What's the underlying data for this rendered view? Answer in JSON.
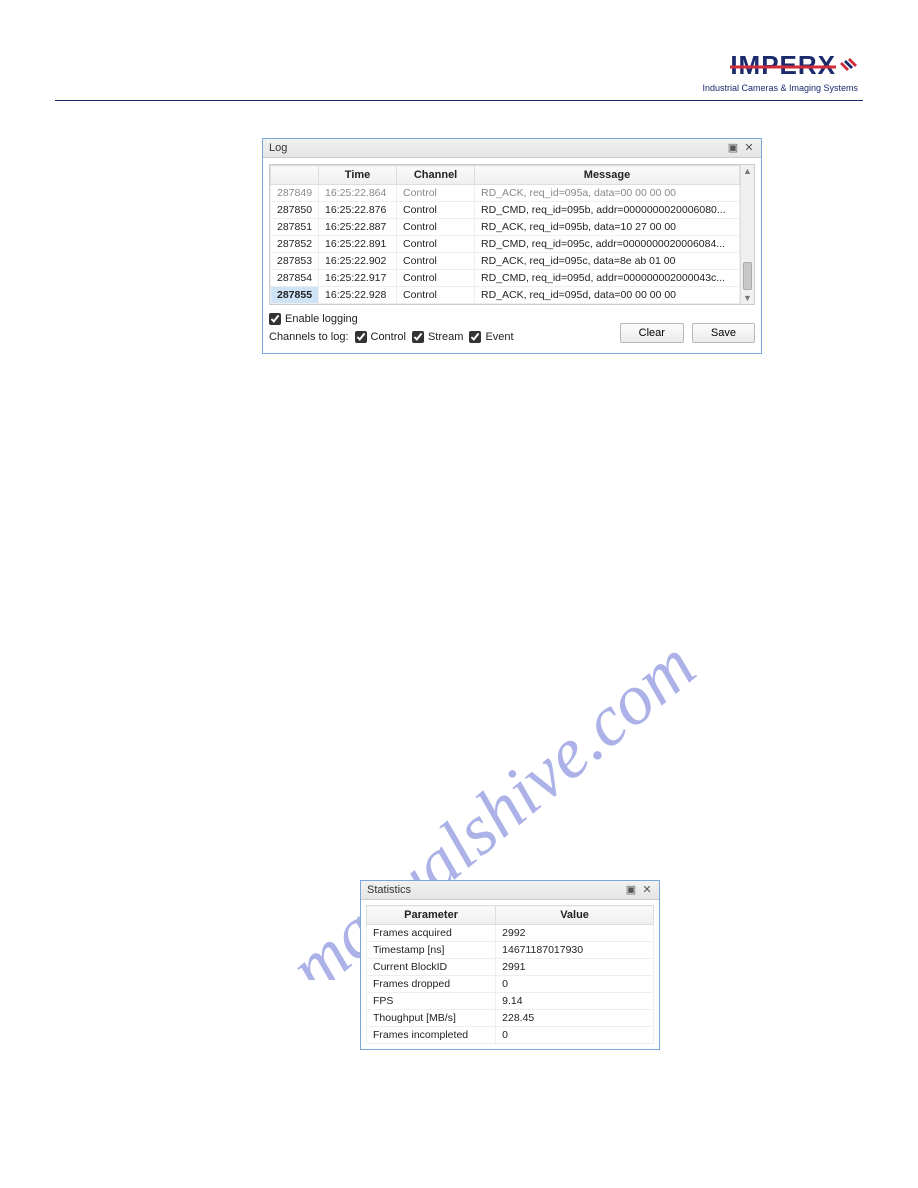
{
  "brand": {
    "name": "IMPERX",
    "tagline": "Industrial Cameras & Imaging Systems"
  },
  "watermark": "manualshive.com",
  "log_panel": {
    "title": "Log",
    "headers": {
      "id": "",
      "time": "Time",
      "channel": "Channel",
      "message": "Message"
    },
    "rows": [
      {
        "id": "287849",
        "time": "16:25:22.864",
        "channel": "Control",
        "message": "RD_ACK, req_id=095a, data=00 00 00 00",
        "cut": true
      },
      {
        "id": "287850",
        "time": "16:25:22.876",
        "channel": "Control",
        "message": "RD_CMD, req_id=095b, addr=0000000020006080..."
      },
      {
        "id": "287851",
        "time": "16:25:22.887",
        "channel": "Control",
        "message": "RD_ACK, req_id=095b, data=10 27 00 00"
      },
      {
        "id": "287852",
        "time": "16:25:22.891",
        "channel": "Control",
        "message": "RD_CMD, req_id=095c, addr=0000000020006084..."
      },
      {
        "id": "287853",
        "time": "16:25:22.902",
        "channel": "Control",
        "message": "RD_ACK, req_id=095c, data=8e ab 01 00"
      },
      {
        "id": "287854",
        "time": "16:25:22.917",
        "channel": "Control",
        "message": "RD_CMD, req_id=095d, addr=000000002000043c..."
      },
      {
        "id": "287855",
        "time": "16:25:22.928",
        "channel": "Control",
        "message": "RD_ACK, req_id=095d, data=00 00 00 00",
        "sel": true
      }
    ],
    "enable_label": "Enable logging",
    "channels_label": "Channels to log:",
    "ch_control": "Control",
    "ch_stream": "Stream",
    "ch_event": "Event",
    "clear_label": "Clear",
    "save_label": "Save"
  },
  "stats_panel": {
    "title": "Statistics",
    "headers": {
      "param": "Parameter",
      "value": "Value"
    },
    "rows": [
      {
        "param": "Frames acquired",
        "value": "2992"
      },
      {
        "param": "Timestamp [ns]",
        "value": "14671187017930"
      },
      {
        "param": "Current BlockID",
        "value": "2991"
      },
      {
        "param": "Frames dropped",
        "value": "0"
      },
      {
        "param": "FPS",
        "value": "9.14"
      },
      {
        "param": "Thoughput [MB/s]",
        "value": "228.45"
      },
      {
        "param": "Frames incompleted",
        "value": "0"
      }
    ]
  }
}
